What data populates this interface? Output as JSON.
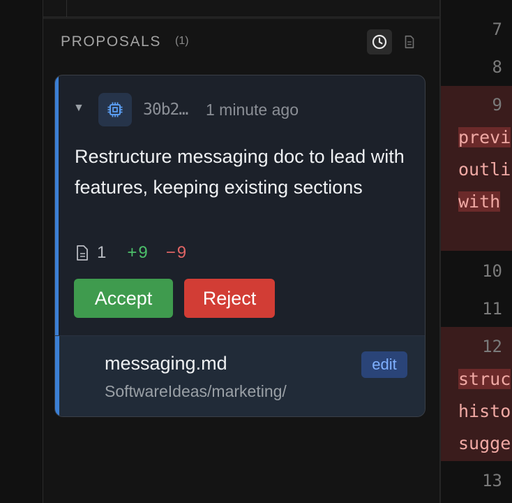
{
  "proposals": {
    "title": "PROPOSALS",
    "count": "(1)",
    "history_icon": "clock-icon",
    "document_icon": "document-icon"
  },
  "card": {
    "caret": "▼",
    "agent_icon": "cpu-chip-icon",
    "commit_id": "30b2…",
    "time": "1 minute ago",
    "title": "Restructure messaging doc to lead with features, keeping existing sections",
    "stats": {
      "files": "1",
      "additions": "+9",
      "deletions": "−9"
    },
    "accept_label": "Accept",
    "reject_label": "Reject",
    "file": {
      "name": "messaging.md",
      "path": "SoftwareIdeas/marketing/",
      "badge": "edit"
    }
  },
  "editor": {
    "line_numbers": [
      "7",
      "8",
      "9",
      "10",
      "11",
      "12",
      "13"
    ],
    "block1": [
      "previ",
      "outli",
      "with "
    ],
    "block2": [
      "struc",
      "histo",
      "sugge"
    ]
  },
  "colors": {
    "accent": "#3b7fd4",
    "accept": "#3f9b4e",
    "reject": "#d23d35",
    "additions": "#4cc06a",
    "deletions": "#e06565"
  }
}
